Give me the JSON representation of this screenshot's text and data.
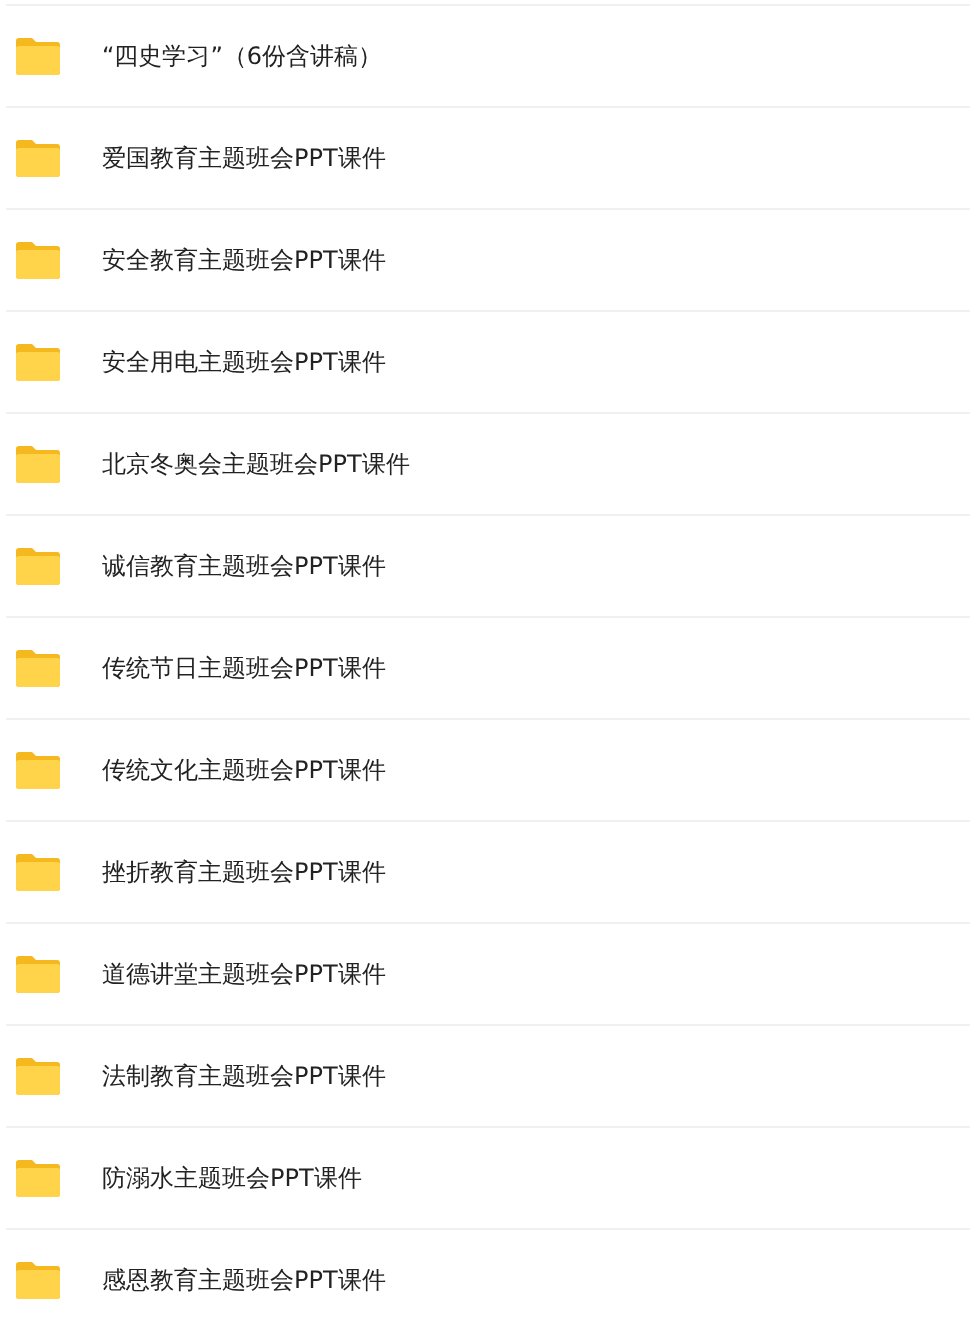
{
  "folders": [
    {
      "name": "“四史学习”（6份含讲稿）"
    },
    {
      "name": "爱国教育主题班会PPT课件"
    },
    {
      "name": "安全教育主题班会PPT课件"
    },
    {
      "name": "安全用电主题班会PPT课件"
    },
    {
      "name": "北京冬奥会主题班会PPT课件"
    },
    {
      "name": "诚信教育主题班会PPT课件"
    },
    {
      "name": "传统节日主题班会PPT课件"
    },
    {
      "name": "传统文化主题班会PPT课件"
    },
    {
      "name": "挫折教育主题班会PPT课件"
    },
    {
      "name": "道德讲堂主题班会PPT课件"
    },
    {
      "name": "法制教育主题班会PPT课件"
    },
    {
      "name": "防溺水主题班会PPT课件"
    },
    {
      "name": "感恩教育主题班会PPT课件"
    }
  ]
}
